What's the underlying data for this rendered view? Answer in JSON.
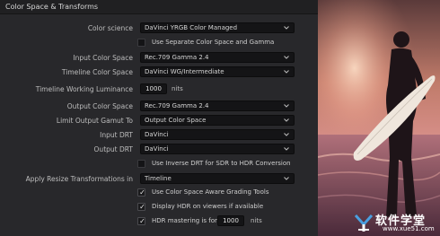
{
  "panel": {
    "title": "Color Space & Transforms",
    "rows": {
      "color_science": {
        "label": "Color science",
        "value": "DaVinci YRGB Color Managed"
      },
      "separate_cs": {
        "label": "Use Separate Color Space and Gamma",
        "checked": false
      },
      "input_cs": {
        "label": "Input Color Space",
        "value": "Rec.709 Gamma 2.4"
      },
      "timeline_cs": {
        "label": "Timeline Color Space",
        "value": "DaVinci WG/Intermediate"
      },
      "timeline_lum": {
        "label": "Timeline Working Luminance",
        "value": "1000",
        "unit": "nits"
      },
      "output_cs": {
        "label": "Output Color Space",
        "value": "Rec.709 Gamma 2.4"
      },
      "limit_gamut": {
        "label": "Limit Output Gamut To",
        "value": "Output Color Space"
      },
      "input_drt": {
        "label": "Input DRT",
        "value": "DaVinci"
      },
      "output_drt": {
        "label": "Output DRT",
        "value": "DaVinci"
      },
      "inverse_drt": {
        "label": "Use Inverse DRT for SDR to HDR Conversion",
        "checked": false
      },
      "apply_resize": {
        "label": "Apply Resize Transformations in",
        "value": "Timeline"
      },
      "aware_grading": {
        "label": "Use Color Space Aware Grading Tools",
        "checked": true
      },
      "display_hdr": {
        "label": "Display HDR on viewers if available",
        "checked": true
      },
      "hdr_mastering": {
        "label": "HDR mastering is for",
        "checked": true,
        "value": "1000",
        "unit": "nits"
      }
    }
  },
  "icons": {
    "chevron": "chevron-down-icon",
    "check": "checkmark-icon"
  },
  "colors": {
    "panel_bg": "#28282b",
    "header_bg": "#202022",
    "field_bg": "#141416"
  },
  "watermark": {
    "text": "软件学堂",
    "url": "www.xue51.com"
  }
}
